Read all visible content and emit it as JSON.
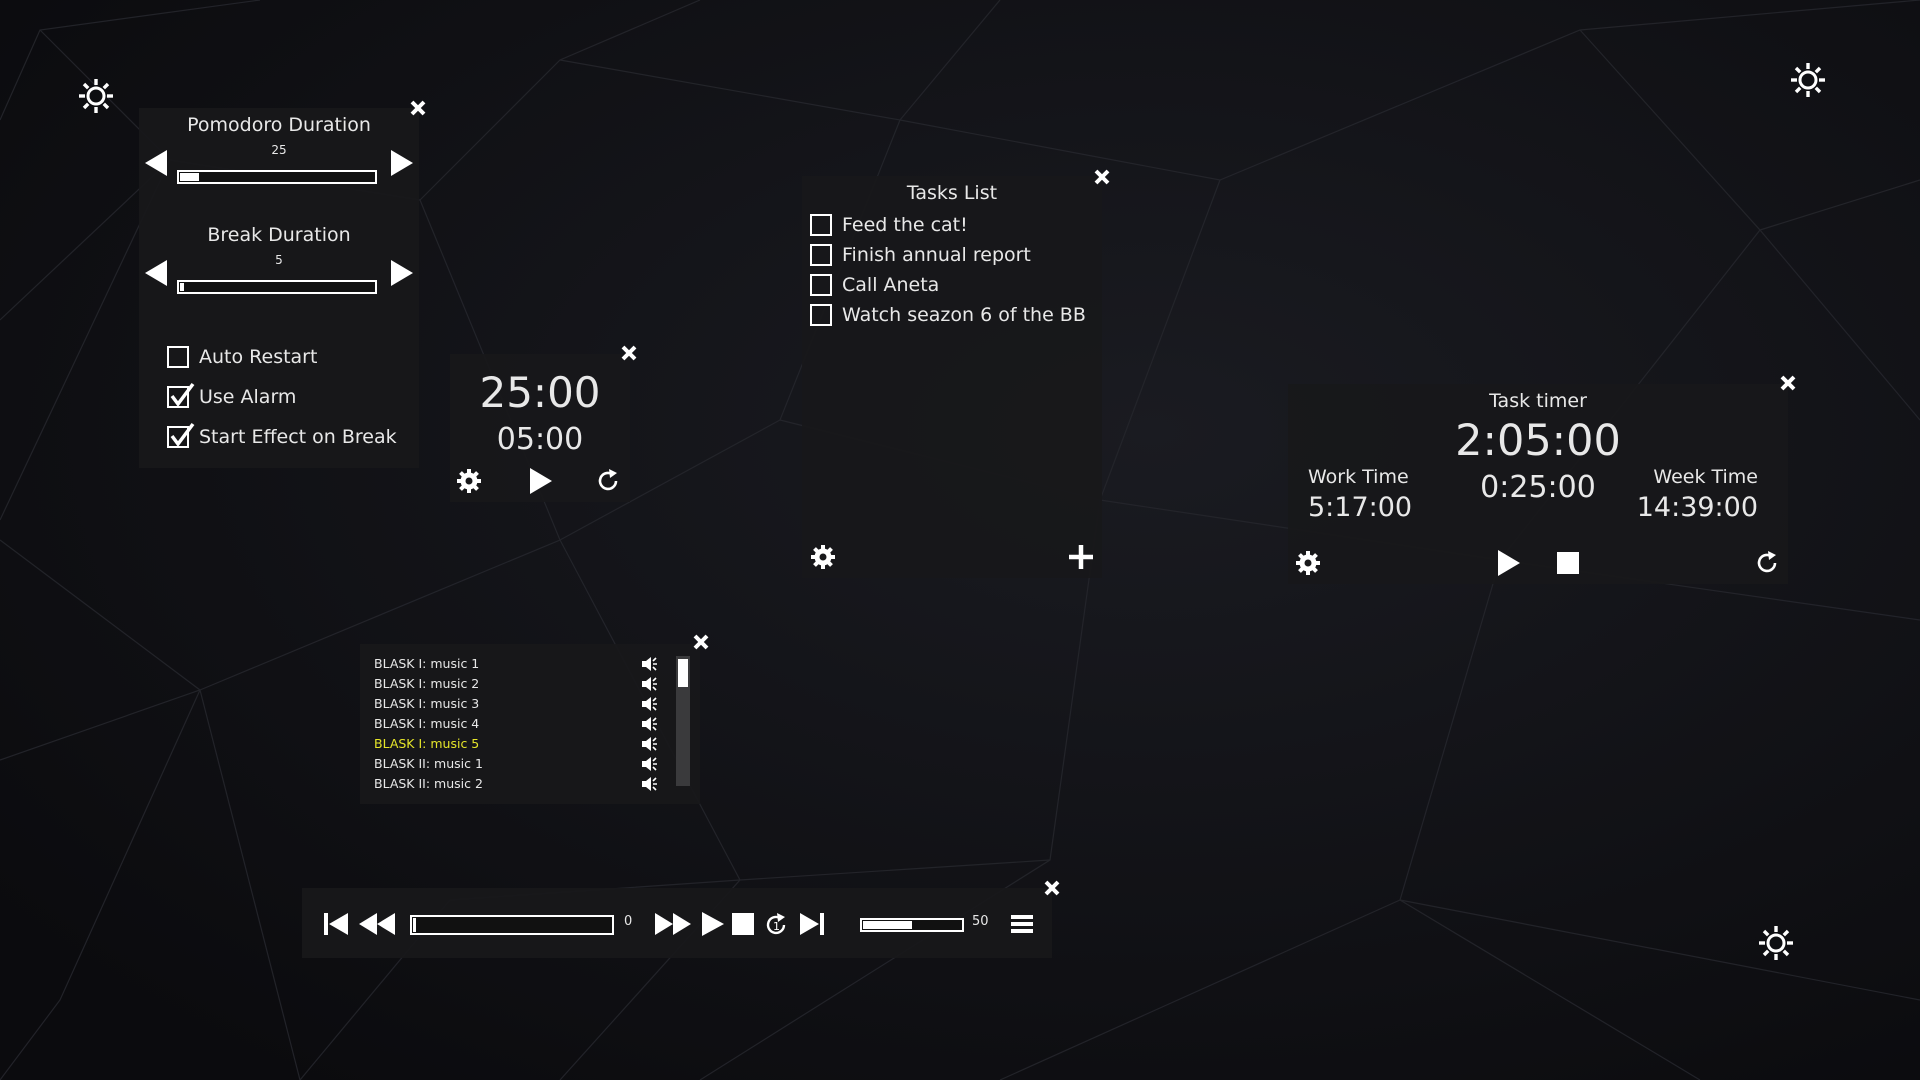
{
  "settings": {
    "pomodoro_label": "Pomodoro Duration",
    "pomodoro_value": "25",
    "pomodoro_fraction": 0.1,
    "break_label": "Break Duration",
    "break_value": "5",
    "break_fraction": 0.02,
    "options": [
      {
        "label": "Auto Restart",
        "checked": false
      },
      {
        "label": "Use Alarm",
        "checked": true
      },
      {
        "label": "Start Effect on Break",
        "checked": true
      }
    ]
  },
  "pomodoro_timer": {
    "work_time": "25:00",
    "break_time": "05:00"
  },
  "tasks": {
    "title": "Tasks List",
    "items": [
      {
        "label": "Feed the cat!",
        "checked": false
      },
      {
        "label": "Finish annual report",
        "checked": false
      },
      {
        "label": "Call Aneta",
        "checked": false
      },
      {
        "label": "Watch seazon 6 of the BB",
        "checked": false
      }
    ]
  },
  "task_timer": {
    "title": "Task timer",
    "main_time": "2:05:00",
    "session_time": "0:25:00",
    "work_label": "Work Time",
    "work_value": "5:17:00",
    "week_label": "Week Time",
    "week_value": "14:39:00"
  },
  "playlist": {
    "tracks": [
      {
        "label": "BLASK I: music 1",
        "active": false
      },
      {
        "label": "BLASK I: music 2",
        "active": false
      },
      {
        "label": "BLASK I: music 3",
        "active": false
      },
      {
        "label": "BLASK I: music 4",
        "active": false
      },
      {
        "label": "BLASK I: music 5",
        "active": true
      },
      {
        "label": "BLASK II: music 1",
        "active": false
      },
      {
        "label": "BLASK II: music 2",
        "active": false
      }
    ],
    "active_color": "#e6e62a"
  },
  "player": {
    "progress_value": "0",
    "progress_fraction": 0,
    "volume_value": "50",
    "volume_fraction": 0.5
  },
  "icons": {
    "corner_settings": "sun-gear-icon",
    "close": "close-icon",
    "settings": "gear-icon",
    "play": "play-icon",
    "reset": "refresh-icon",
    "add": "plus-icon",
    "stop": "stop-icon",
    "menu": "menu-icon"
  }
}
